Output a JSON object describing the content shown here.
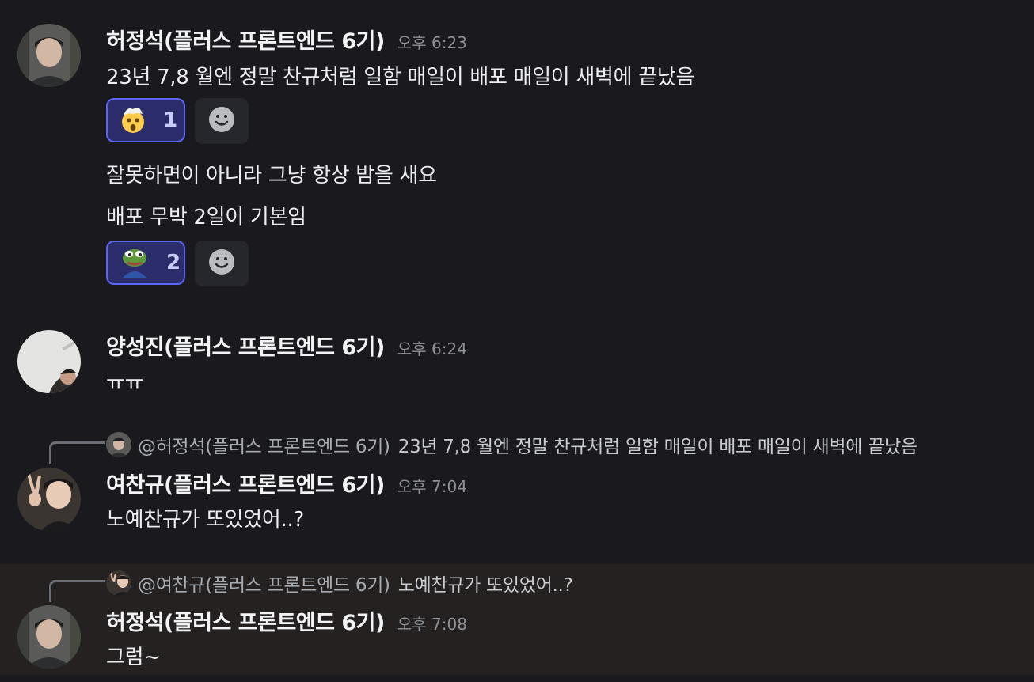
{
  "messages": [
    {
      "author": "허정석(플러스 프론트엔드 6기)",
      "time": "오후 6:23",
      "lines": [
        "23년 7,8 월엔 정말 찬규처럼 일함 매일이 배포 매일이 새벽에 끝났음"
      ],
      "reaction": {
        "emoji": "exploding-head-emoji",
        "count": "1"
      },
      "lines2": [
        "잘못하면이 아니라 그냥 항상 밤을 새요",
        "배포 무박 2일이 기본임"
      ],
      "reaction2": {
        "emoji": "pepe-frog-emoji",
        "count": "2"
      }
    },
    {
      "author": "양성진(플러스 프론트엔드 6기)",
      "time": "오후 6:24",
      "lines": [
        "ㅠㅠ"
      ]
    },
    {
      "reply": {
        "mention": "@허정석(플러스 프론트엔드 6기)",
        "text": "23년 7,8 월엔 정말 찬규처럼 일함 매일이 배포 매일이 새벽에 끝났음"
      },
      "author": "여찬규(플러스 프론트엔드 6기)",
      "time": "오후 7:04",
      "lines": [
        "노예찬규가 또있었어..?"
      ]
    },
    {
      "reply": {
        "mention": "@여찬규(플러스 프론트엔드 6기)",
        "text": "노예찬규가 또있었어..?"
      },
      "author": "허정석(플러스 프론트엔드 6기)",
      "time": "오후 7:08",
      "lines": [
        "그럼~"
      ]
    }
  ],
  "icons": {
    "add_reaction": "smiley-add-reaction-icon"
  },
  "colors": {
    "reaction_border": "#5c64f4",
    "reaction_bg": "#2b2d6a",
    "highlight_bg": "#242120"
  }
}
